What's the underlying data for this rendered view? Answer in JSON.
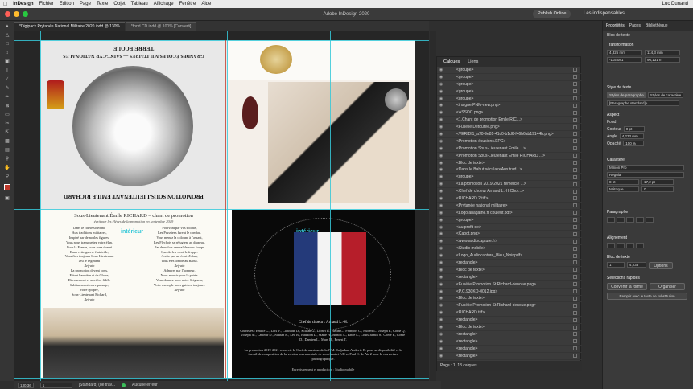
{
  "menubar": {
    "items": [
      "InDesign",
      "Fichier",
      "Edition",
      "Page",
      "Texte",
      "Objet",
      "Tableau",
      "Affichage",
      "Fenêtre",
      "Aide"
    ],
    "user": "Luc Dunand"
  },
  "titlebar": {
    "title": "Adobe InDesign 2020",
    "publish": "Publish Online",
    "workspace": "Les indispensables"
  },
  "docs": [
    {
      "label": "*Digipack Prytanée National Militaire 2020.indd @ 130%"
    },
    {
      "label": "*fond CD.indd @ 100% [Converti]"
    }
  ],
  "page_text": {
    "top_left_title": "TERRE ÉCOLE",
    "top_left_sub": "GRANDES ÉCOLES MILITAIRES — SAINT-CYR NATIONALES",
    "top_left_bottom": "PROMOTION SOUS-LIEUTENANT ÉMILE RICHARD",
    "chant_title": "Sous-Lieutenant Émile RICHARD – chant de promotion",
    "chant_sub": "écrit par les élèves de la promotion en septembre 2019",
    "interior": "intérieur",
    "poem_left": [
      "Dans le fidèle souvenir",
      "Aux traditions militaires,",
      "Inspiré par de nobles figures,",
      "Vous nous transmettez votre élan.",
      "Pour la France, vous avez donné",
      "Dans cette guerre fratricide,",
      "Vous êtes toujours Sous-Lieutenant",
      "Jeu le régiment",
      "Refrain",
      "La promotion devant vous,",
      "Fêtant bannière et de Gloire,",
      "Dévouement et sacrifice fidèle",
      "Sublimement votre passage,",
      "Votre épopée,",
      "Sous-Lieutenant Richard,",
      "Refrain"
    ],
    "poem_right": [
      "Pourvant par vos soldats,",
      "Les Prussiens furent le combat.",
      "Vous menez la colonne à l'assaut,",
      "Les Flechois se réfugient au drapeau.",
      "Par deux fois une rafale vous frappe",
      "Que de feu vient le frappe.",
      "Arrête par un éclat d'obus,",
      "Vous êtes tombé au Bahut.",
      "Refrain",
      "Admirer par l'honneur,",
      "Nous mourir pour la patrie.",
      "Vous donnez pour notre Seigneur,",
      "Votre exemple nous guidera toujours.",
      "Refrain"
    ],
    "credits": "Choristes : Emilie C., Loïs V., Clothilde D., Killian G., Lionel R., Justin C., François C., Hubert L., Joseph F., Côme Q., Joseph M., Casimir D., Nathan R., Léo R., Baudoin L., Marie H., Benoit A., Brice L., Louis-Jamin S., Côme P., Côme D., Damien L., Marc D., Ernest T.",
    "chef": "Chef de choeur : Arnaud L.-H.",
    "bottom_note": "La promotion 2019-2021 remercie le Chef de musique de la WM. l'adjudant Andovic R. pour sa disponibilité et le travail de composition de la version instrumentale de son chant et l'élève Paul C. de Air 2 pour le couverture photographique.",
    "studio": "Enregistrement et production : Studio mobile"
  },
  "layers": {
    "tabs": [
      "Calques",
      "Liens"
    ],
    "rows": [
      "<groupe>",
      "<groupe>",
      "<groupe>",
      "<groupe>",
      "<groupe>",
      "<insigne PNM-new.png>",
      "<ASSOC.png>",
      "<1.Chant de promotion Emile RIC...>",
      "<Fusélie Détourée.png>",
      "<VERIDI1_a70-9e81-41c0-b1d6-f46b6ab19144b.png>",
      "<Promotion écusions.EPC>",
      "<Promotion Sous-Lieutenant Émile ...>",
      "<Promotion Sous-Lieutenant Émile RICHARD ...>",
      "<Bloc de texte>",
      "<Dans le Bahut séculaireAux trad...>",
      "<groupe>",
      "<La promotion 2019-2021 remercie ...>",
      "<Chef de choeur Arnaud L.-H.Chor...>",
      "<RICHARD 2.tiff>",
      "<Prytanée national militaire>",
      "<Logo anagame.fr couleur.pdf>",
      "<groupe>",
      "<au profit de>",
      "<Cabot.png>",
      "<www.audiocapture.fr>",
      "<Studio mobile>",
      "<Logo_Audiocapture_Bleu_Noir.pdf>",
      "<rectangle>",
      "<Bloc de texte>",
      "<rectangle>",
      "<Fusélie Promotion St Richard-denoue.png>",
      "<P.C.930KO-0012.jpg>",
      "<Bloc de texte>",
      "<Fusélie Promotion St Richard-denoue.png>",
      "<RICHARD.tiff>",
      "<rectangle>",
      "<Bloc de texte>",
      "<rectangle>",
      "<rectangle>",
      "<rectangle>",
      "<rectangle>"
    ],
    "footer": "Page : 1, 13 calques"
  },
  "props": {
    "tabs": [
      "Propriétés",
      "Pages",
      "Bibliothèque"
    ],
    "selection": "Bloc de texte",
    "transform": "Transformation",
    "x": "4,325 mm",
    "y": "-115,081",
    "w": "114,3 mm",
    "h": "96,131 m",
    "text_style": "Style de texte",
    "para_styles_tab": "Styles de paragraphe",
    "char_styles_tab": "Styles de caractère",
    "para_style": "[Paragraphe standard]+",
    "appearance": "Aspect",
    "fill": "Fond",
    "stroke": "Contour",
    "stroke_val": "0 pt",
    "corner": "Angle",
    "corner_val": "4,233 mm",
    "opacity": "Opacité",
    "opacity_val": "100 %",
    "character": "Caractère",
    "font": "Minion Pro",
    "font_style": "Regular",
    "size": "8 pt",
    "leading": "17,2 pt",
    "kerning": "Métrique",
    "tracking": "0",
    "paragraph": "Paragraphe",
    "align": "Alignement",
    "frame": "Bloc de texte",
    "cols": "1",
    "gutter": "4,233",
    "options": "Options",
    "quick": "Sélections rapides",
    "convert": "Convertir la forme",
    "arrange": "Organiser",
    "replace": "Remplir avec le texte de substitution"
  },
  "status": {
    "zoom": "130,36",
    "page": "1",
    "style": "[Standard] (de trav...",
    "state": "Aucune erreur"
  },
  "colors": {
    "guide": "#36c8d8",
    "accent": "#c0392b"
  }
}
